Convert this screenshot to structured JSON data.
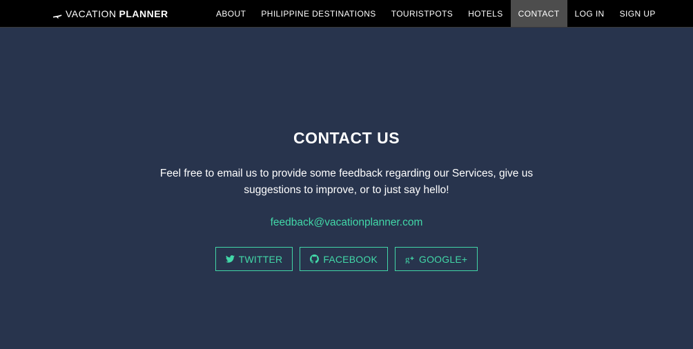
{
  "brand": {
    "light": "VACATION",
    "bold": "PLANNER",
    "icon": "airplane-icon"
  },
  "nav": {
    "items": [
      {
        "label": "ABOUT"
      },
      {
        "label": "PHILIPPINE DESTINATIONS"
      },
      {
        "label": "TOURISTPOTS"
      },
      {
        "label": "HOTELS"
      },
      {
        "label": "CONTACT",
        "active": true
      },
      {
        "label": "LOG IN"
      },
      {
        "label": "SIGN UP"
      }
    ]
  },
  "contact": {
    "title": "CONTACT US",
    "description": "Feel free to email us to provide some feedback regarding our Services, give us suggestions to improve, or to just say hello!",
    "email": "feedback@vacationplanner.com",
    "socials": [
      {
        "label": "TWITTER",
        "icon": "twitter-icon"
      },
      {
        "label": "FACEBOOK",
        "icon": "github-icon"
      },
      {
        "label": "GOOGLE+",
        "icon": "google-plus-icon"
      }
    ]
  },
  "colors": {
    "background": "#28344d",
    "navbar": "#000000",
    "active_nav": "#4d4d4d",
    "accent": "#42d8a8"
  }
}
